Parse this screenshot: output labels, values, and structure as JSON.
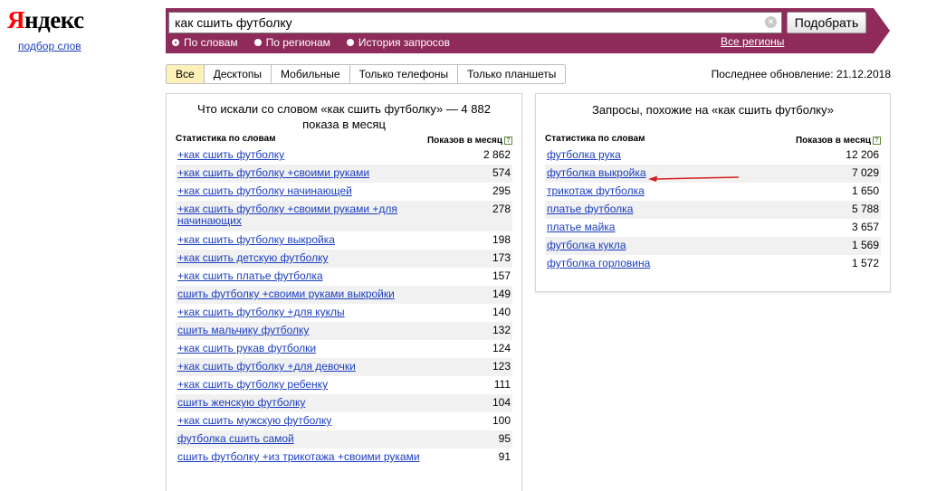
{
  "logo": {
    "first_letter": "Я",
    "rest": "ндекс",
    "subtitle": "подбор слов"
  },
  "search": {
    "value": "как сшить футболку",
    "clear": "×",
    "button": "Подобрать"
  },
  "modes": [
    {
      "label": "По словам",
      "selected": true
    },
    {
      "label": "По регионам",
      "selected": false
    },
    {
      "label": "История запросов",
      "selected": false
    }
  ],
  "regions_link": "Все регионы",
  "tabs": [
    {
      "label": "Все",
      "active": true
    },
    {
      "label": "Десктопы",
      "active": false
    },
    {
      "label": "Мобильные",
      "active": false
    },
    {
      "label": "Только телефоны",
      "active": false
    },
    {
      "label": "Только планшеты",
      "active": false
    }
  ],
  "last_update": "Последнее обновление: 21.12.2018",
  "left_panel": {
    "title": "Что искали со словом «как сшить футболку» — 4 882 показа в месяц",
    "col_query": "Статистика по словам",
    "col_shows": "Показов в месяц",
    "help": "?",
    "rows": [
      {
        "q": "+как сшить футболку",
        "n": "2 862"
      },
      {
        "q": "+как сшить футболку +своими руками",
        "n": "574"
      },
      {
        "q": "+как сшить футболку начинающей",
        "n": "295"
      },
      {
        "q": "+как сшить футболку +своими руками +для начинающих",
        "n": "278"
      },
      {
        "q": "+как сшить футболку выкройка",
        "n": "198"
      },
      {
        "q": "+как сшить детскую футболку",
        "n": "173"
      },
      {
        "q": "+как сшить платье футболка",
        "n": "157"
      },
      {
        "q": "сшить футболку +своими руками выкройки",
        "n": "149"
      },
      {
        "q": "+как сшить футболку +для куклы",
        "n": "140"
      },
      {
        "q": "сшить мальчику футболку",
        "n": "132"
      },
      {
        "q": "+как сшить рукав футболки",
        "n": "124"
      },
      {
        "q": "+как сшить футболку +для девочки",
        "n": "123"
      },
      {
        "q": "+как сшить футболку ребенку",
        "n": "111"
      },
      {
        "q": "сшить женскую футболку",
        "n": "104"
      },
      {
        "q": "+как сшить мужскую футболку",
        "n": "100"
      },
      {
        "q": "футболка сшить самой",
        "n": "95"
      },
      {
        "q": "сшить футболку +из трикотажа +своими руками",
        "n": "91"
      }
    ]
  },
  "right_panel": {
    "title": "Запросы, похожие на «как сшить футболку»",
    "col_query": "Статистика по словам",
    "col_shows": "Показов в месяц",
    "help": "?",
    "rows": [
      {
        "q": "футболка рука",
        "n": "12 206"
      },
      {
        "q": "футболка выкройка",
        "n": "7 029"
      },
      {
        "q": "трикотаж футболка",
        "n": "1 650"
      },
      {
        "q": "платье футболка",
        "n": "5 788"
      },
      {
        "q": "платье майка",
        "n": "3 657"
      },
      {
        "q": "футболка кукла",
        "n": "1 569"
      },
      {
        "q": "футболка горловина",
        "n": "1 572"
      }
    ]
  },
  "colors": {
    "brand_red": "#ff0000",
    "search_band": "#8e2b5a",
    "link": "#1a3dc1",
    "active_tab": "#fdf0b8",
    "annotation_arrow": "#d21d1d"
  }
}
